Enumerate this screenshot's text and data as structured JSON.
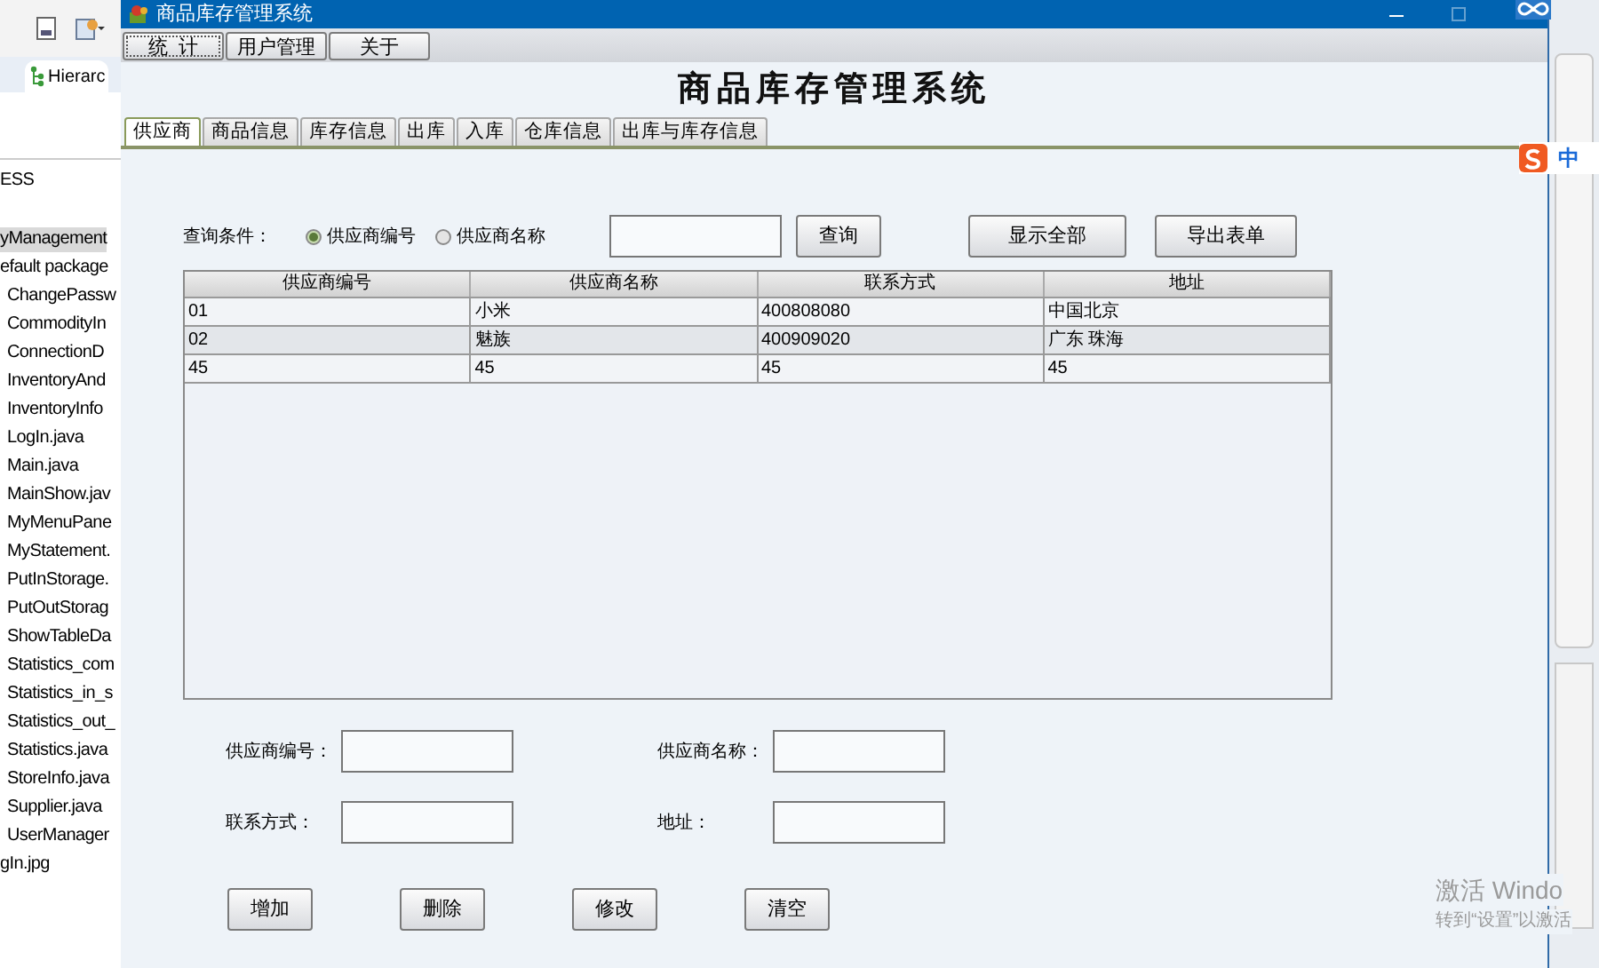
{
  "ide": {
    "tab": "Hierarc",
    "tree": [
      {
        "label": "ESS",
        "selected": false
      },
      {
        "label": "yManagement",
        "selected": true,
        "children": [
          {
            "label": "efault package",
            "selected": false,
            "children": [
              {
                "label": "ChangePassw",
                "selected": false
              },
              {
                "label": "CommodityIn",
                "selected": false
              },
              {
                "label": "ConnectionD",
                "selected": false
              },
              {
                "label": "InventoryAnd",
                "selected": false
              },
              {
                "label": "InventoryInfo",
                "selected": false
              },
              {
                "label": "LogIn.java",
                "selected": false
              },
              {
                "label": "Main.java",
                "selected": false
              },
              {
                "label": "MainShow.jav",
                "selected": false
              },
              {
                "label": "MyMenuPane",
                "selected": false
              },
              {
                "label": "MyStatement.",
                "selected": false
              },
              {
                "label": "PutInStorage.",
                "selected": false
              },
              {
                "label": "PutOutStorag",
                "selected": false
              },
              {
                "label": "ShowTableDa",
                "selected": false
              },
              {
                "label": "Statistics_com",
                "selected": false
              },
              {
                "label": "Statistics_in_s",
                "selected": false
              },
              {
                "label": "Statistics_out_",
                "selected": false
              },
              {
                "label": "Statistics.java",
                "selected": false
              },
              {
                "label": "StoreInfo.java",
                "selected": false
              },
              {
                "label": "Supplier.java",
                "selected": false
              },
              {
                "label": "UserManager",
                "selected": false
              }
            ]
          },
          {
            "label": "gIn.jpg",
            "selected": false
          }
        ]
      }
    ]
  },
  "window": {
    "title": "商品库存管理系统"
  },
  "menu": [
    {
      "label": "统  计",
      "focused": true
    },
    {
      "label": "用户管理",
      "focused": false
    },
    {
      "label": "关于",
      "focused": false
    }
  ],
  "heading": "商品库存管理系统",
  "tabs": [
    {
      "label": "供应商",
      "selected": true
    },
    {
      "label": "商品信息",
      "selected": false
    },
    {
      "label": "库存信息",
      "selected": false
    },
    {
      "label": "出库",
      "selected": false
    },
    {
      "label": "入库",
      "selected": false
    },
    {
      "label": "仓库信息",
      "selected": false
    },
    {
      "label": "出库与库存信息",
      "selected": false
    }
  ],
  "query": {
    "label": "查询条件：",
    "options": [
      {
        "label": "供应商编号",
        "selected": true
      },
      {
        "label": "供应商名称",
        "selected": false
      }
    ],
    "search_button": "查询",
    "buttons": [
      "显示全部",
      "导出表单"
    ]
  },
  "table": {
    "columns": [
      "供应商编号",
      "供应商名称",
      "联系方式",
      "地址"
    ],
    "rows": [
      [
        "01",
        "小米",
        "400808080",
        "中国北京"
      ],
      [
        "02",
        "魅族",
        "400909020",
        "广东 珠海"
      ],
      [
        "45",
        "45",
        "45",
        "45"
      ]
    ]
  },
  "form": {
    "fields": [
      {
        "label": "供应商编号："
      },
      {
        "label": "供应商名称："
      },
      {
        "label": "联系方式："
      },
      {
        "label": "地址："
      }
    ],
    "buttons": [
      "增加",
      "删除",
      "修改",
      "清空"
    ]
  },
  "ime": {
    "label": "中"
  },
  "activation": {
    "title": "激活 Windo",
    "subtitle": "转到“设置”以激活"
  }
}
